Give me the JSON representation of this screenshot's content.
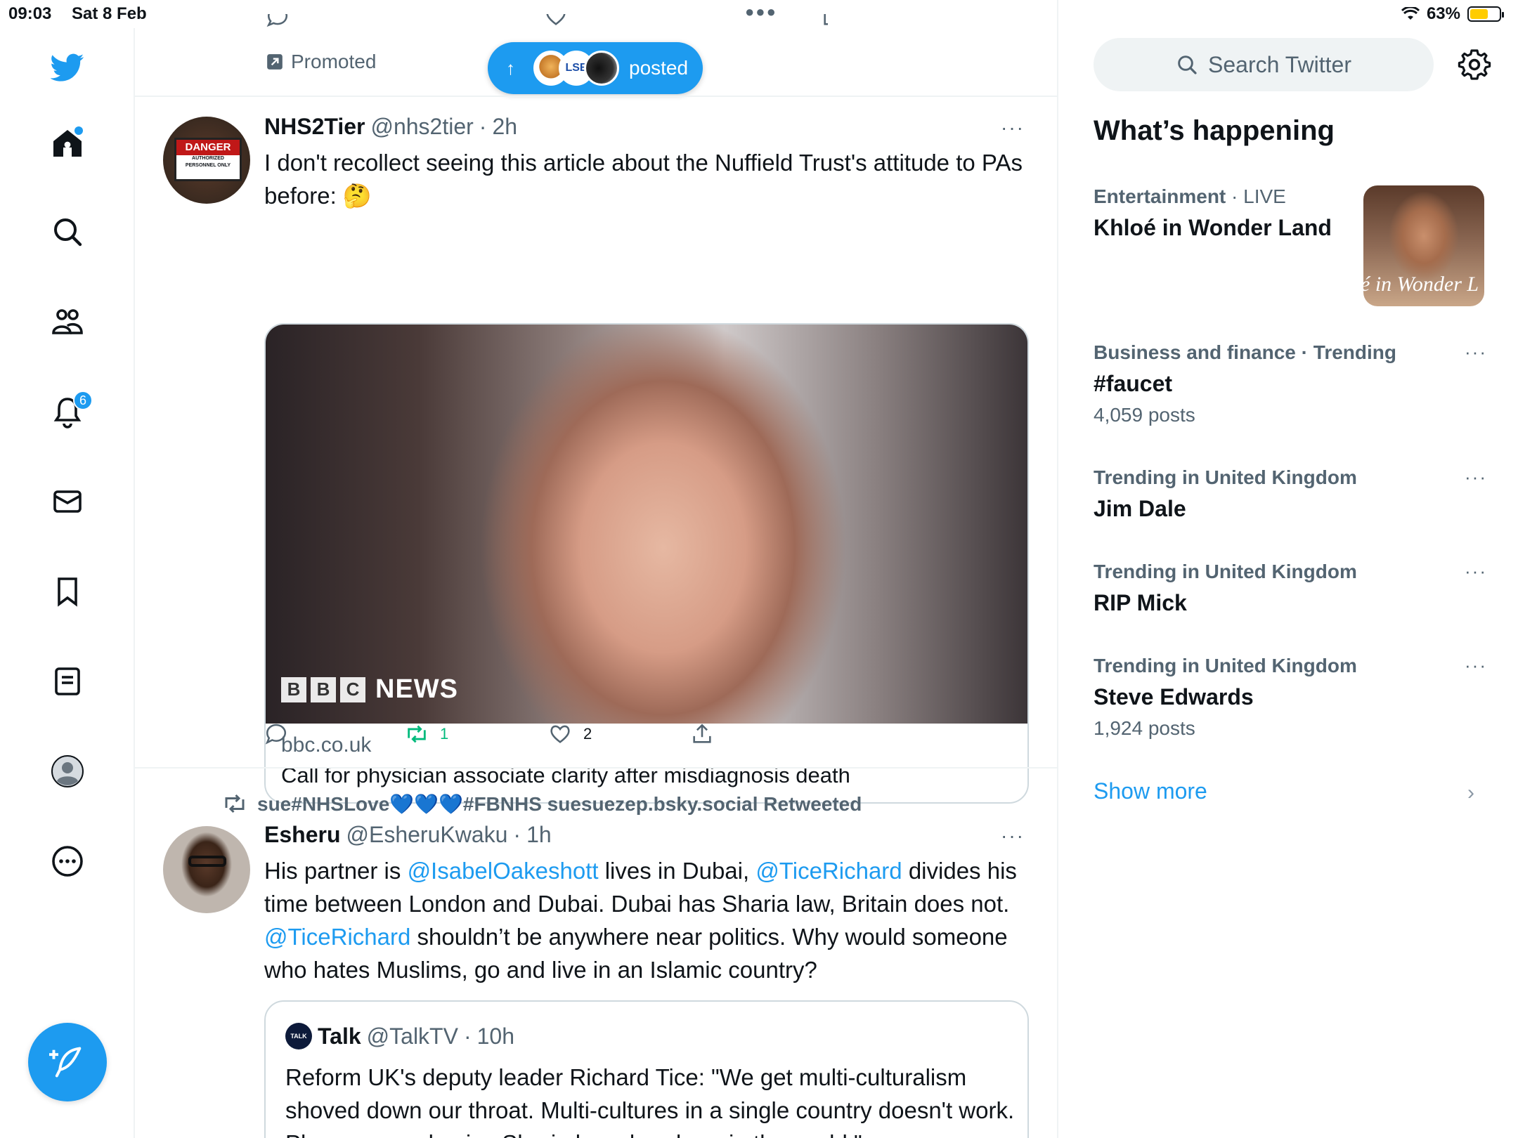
{
  "status_bar": {
    "time": "09:03",
    "date": "Sat 8 Feb",
    "battery": "63%",
    "battery_level": 0.63
  },
  "nav": {
    "notifications_badge": "6",
    "items": [
      "twitter-logo",
      "home",
      "explore",
      "communities",
      "notifications",
      "messages",
      "bookmarks",
      "lists",
      "profile",
      "more"
    ]
  },
  "feed": {
    "promoted_label": "Promoted",
    "posted_pill": "posted",
    "tweet1": {
      "name": "NHS2Tier",
      "handle": "@nhs2tier",
      "dot": "·",
      "time": "2h",
      "more": "···",
      "text": "I don't recollect seeing this article about the Nuffield Trust's attitude to PAs before: 🤔",
      "card": {
        "bbc_letters": [
          "B",
          "B",
          "C"
        ],
        "bbc_news": "NEWS",
        "domain": "bbc.co.uk",
        "title": "Call for physician associate clarity after misdiagnosis death"
      },
      "retweets": "1",
      "likes": "2"
    },
    "retweet_line": "sue#NHSLove💙💙💙#FBNHS suesuezep.bsky.social Retweeted",
    "tweet2": {
      "name": "Esheru",
      "handle": "@EsheruKwaku",
      "dot": "·",
      "time": "1h",
      "more": "···",
      "text_parts": [
        "His partner is ",
        "@IsabelOakeshott",
        " lives in Dubai, ",
        "@TiceRichard",
        " divides his time between London and Dubai. Dubai has Sharia law, Britain does not. ",
        "@TiceRichard",
        " shouldn’t be anywhere near politics. Why would someone who hates Muslims, go and live in an Islamic country?"
      ],
      "quote": {
        "avatar_text": "TALK",
        "name": "Talk",
        "handle": "@TalkTV",
        "dot": "·",
        "time": "10h",
        "text": "Reform UK's deputy leader Richard Tice: \"We get multi-culturalism shoved down our throat. Multi-cultures in a single country doesn't work. Please go and enjoy Sharia law elsewhere in the world.\""
      }
    }
  },
  "sidebar": {
    "search_placeholder": "Search Twitter",
    "whats_happening": "What’s happening",
    "trends": [
      {
        "category": "Entertainment",
        "sep": " · ",
        "extra": "LIVE",
        "name": "Khloé in Wonder Land",
        "count": ""
      },
      {
        "category": "Business and finance",
        "sep": " · ",
        "extra": "Trending",
        "name": "#faucet",
        "count": "4,059 posts"
      },
      {
        "category": "Trending in United Kingdom",
        "sep": "",
        "extra": "",
        "name": "Jim Dale",
        "count": ""
      },
      {
        "category": "Trending in United Kingdom",
        "sep": "",
        "extra": "",
        "name": "RIP Mick",
        "count": ""
      },
      {
        "category": "Trending in United Kingdom",
        "sep": "",
        "extra": "",
        "name": "Steve Edwards",
        "count": "1,924 posts"
      }
    ],
    "thumb_text": "é in Wonder L",
    "show_more": "Show more",
    "more_dots": "···",
    "chevron": "›"
  },
  "colors": {
    "accent": "#1d9bf0",
    "retweet_green": "#00ba7c",
    "text_secondary": "#536471"
  }
}
